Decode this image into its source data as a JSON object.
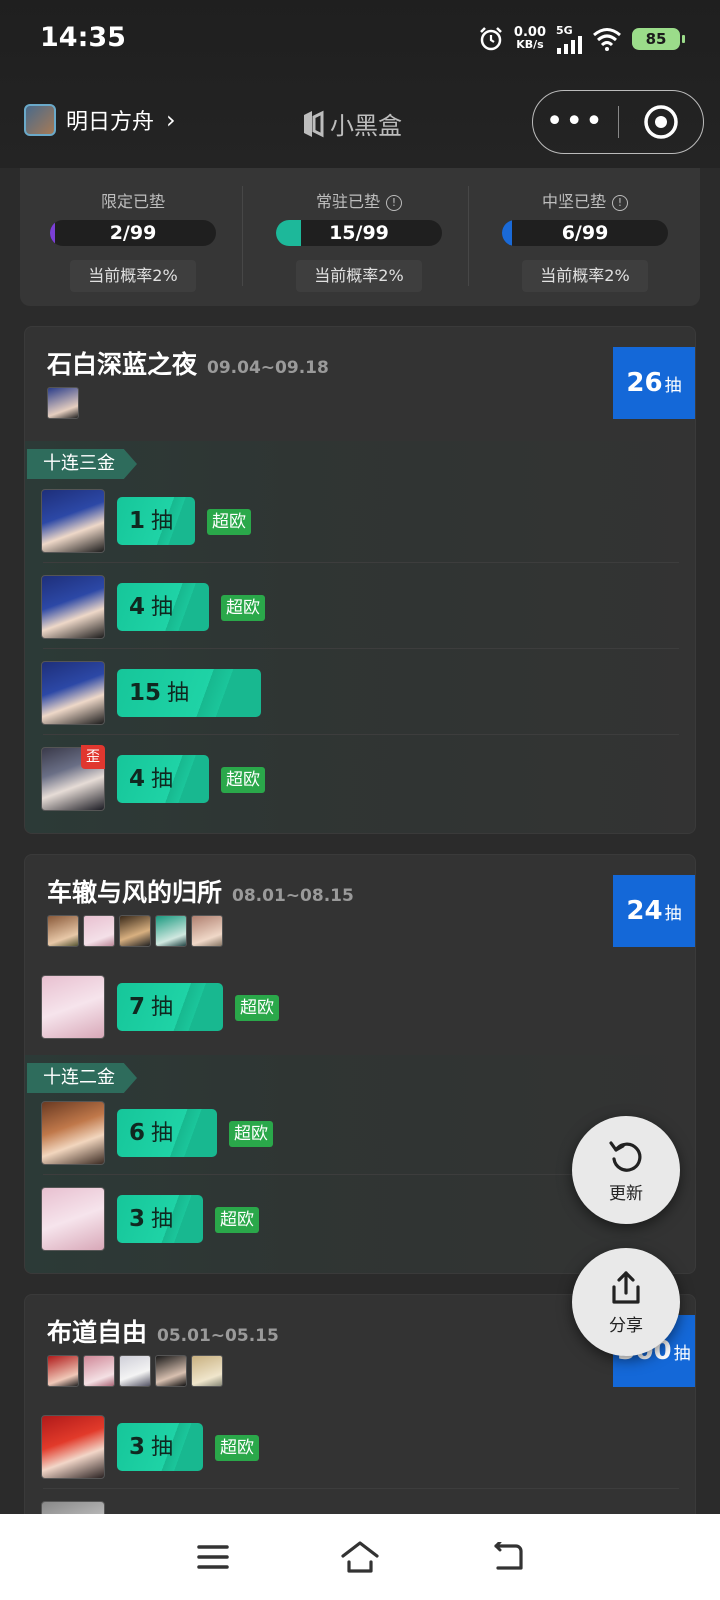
{
  "status_bar": {
    "time": "14:35",
    "net_speed_value": "0.00",
    "net_speed_unit": "KB/s",
    "network": "5G",
    "battery": "85"
  },
  "title_bar": {
    "game_name": "明日方舟",
    "chevron": "›",
    "brand": "小黑盒",
    "more": "•••"
  },
  "pity": [
    {
      "label": "限定已垫",
      "info": false,
      "value": "2/99",
      "fraction": 0.02,
      "color": "#7b3fd6",
      "rate": "当前概率2%"
    },
    {
      "label": "常驻已垫",
      "info": true,
      "value": "15/99",
      "fraction": 0.15,
      "color": "#1db89a",
      "rate": "当前概率2%"
    },
    {
      "label": "中坚已垫",
      "info": true,
      "value": "6/99",
      "fraction": 0.06,
      "color": "#1a6ad8",
      "rate": "当前概率2%"
    }
  ],
  "banners": [
    {
      "name": "石白深蓝之夜",
      "dates": "09.04~09.18",
      "total": "26",
      "unit": "抽",
      "group_tag": "十连三金",
      "rows": [
        {
          "pulls": "1",
          "unit": "抽",
          "luck": "超欧",
          "badge": ""
        },
        {
          "pulls": "4",
          "unit": "抽",
          "luck": "超欧",
          "badge": ""
        },
        {
          "pulls": "15",
          "unit": "抽",
          "luck": "",
          "badge": ""
        },
        {
          "pulls": "4",
          "unit": "抽",
          "luck": "超欧",
          "badge": "歪"
        }
      ]
    },
    {
      "name": "车辙与风的归所",
      "dates": "08.01~08.15",
      "total": "24",
      "unit": "抽",
      "group_tag": "十连二金",
      "rows": [
        {
          "pulls": "7",
          "unit": "抽",
          "luck": "超欧"
        },
        {
          "pulls": "6",
          "unit": "抽",
          "luck": "超欧"
        },
        {
          "pulls": "3",
          "unit": "抽",
          "luck": "超欧"
        }
      ]
    },
    {
      "name": "布道自由",
      "dates": "05.01~05.15",
      "total": "300",
      "unit": "抽",
      "rows": [
        {
          "pulls": "3",
          "unit": "抽",
          "luck": "超欧"
        }
      ]
    }
  ],
  "fab": {
    "refresh_label": "更新",
    "share_label": "分享"
  },
  "colors": {
    "accent_green": "#1fd3a6",
    "total_blue": "#1468d8",
    "luck_green": "#2aa84a",
    "warn_red": "#e0372f"
  }
}
